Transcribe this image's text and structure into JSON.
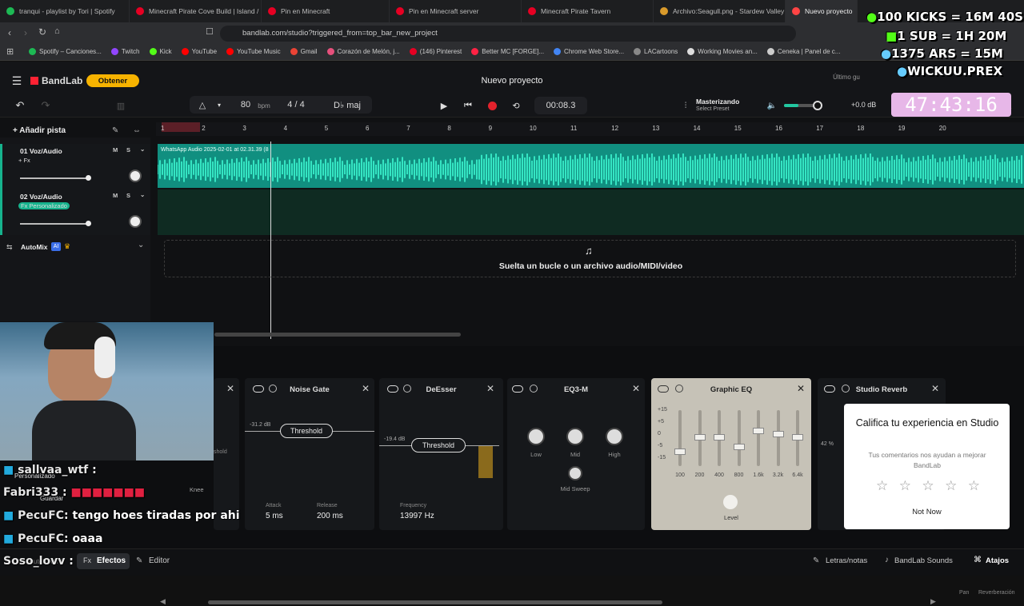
{
  "browser": {
    "tabs": [
      {
        "label": "tranqui - playlist by Tori | Spotify",
        "color": "#1db954"
      },
      {
        "label": "Minecraft Pirate Cove Build | Island /",
        "color": "#e60023"
      },
      {
        "label": "Pin en Minecraft",
        "color": "#e60023"
      },
      {
        "label": "Pin en Minecraft server",
        "color": "#e60023"
      },
      {
        "label": "Minecraft Pirate Tavern",
        "color": "#e60023"
      },
      {
        "label": "Archivo:Seagull.png - Stardew Valley",
        "color": "#d99a2b"
      },
      {
        "label": "Nuevo proyecto",
        "color": "#f44"
      }
    ],
    "url": "bandlab.com/studio?triggered_from=top_bar_new_project",
    "bookmarks": [
      {
        "label": "Spotify – Canciones...",
        "color": "#1db954"
      },
      {
        "label": "Twitch",
        "color": "#9146ff"
      },
      {
        "label": "Kick",
        "color": "#53fc18"
      },
      {
        "label": "YouTube",
        "color": "#f00"
      },
      {
        "label": "YouTube Music",
        "color": "#f00"
      },
      {
        "label": "Gmail",
        "color": "#ea4335"
      },
      {
        "label": "Corazón de Melón, j...",
        "color": "#e6507c"
      },
      {
        "label": "(146) Pinterest",
        "color": "#e60023"
      },
      {
        "label": "Better MC [FORGE]...",
        "color": "#f24"
      },
      {
        "label": "Chrome Web Store...",
        "color": "#4285f4"
      },
      {
        "label": "LACartoons",
        "color": "#888"
      },
      {
        "label": "Working Movies an...",
        "color": "#ddd"
      },
      {
        "label": "Ceneka | Panel de c...",
        "color": "#ccc"
      }
    ]
  },
  "studio": {
    "brand": "BandLab",
    "upgrade": "Obtener",
    "project_title": "Nuevo proyecto",
    "last_saved": "Último gu",
    "bpm": "80",
    "bpm_unit": "bpm",
    "time_sig": "4 / 4",
    "key": "D♭ maj",
    "time": "00:08.3",
    "mastering": "Masterizando",
    "preset": "Select Preset",
    "db": "+0.0 dB",
    "add_track": "Añadir pista",
    "ruler": [
      "1",
      "2",
      "3",
      "4",
      "5",
      "6",
      "7",
      "8",
      "9",
      "10",
      "11",
      "12",
      "13",
      "14",
      "15",
      "16",
      "17",
      "18",
      "19",
      "20"
    ],
    "tracks": [
      {
        "name": "01  Voz/Audio",
        "fx": "+ Fx",
        "m": "M",
        "s": "S"
      },
      {
        "name": "02  Voz/Audio",
        "fx": "Fx Personalizado",
        "m": "M",
        "s": "S"
      }
    ],
    "clip_label": "WhatsApp Audio 2025-02-01 at 02.31.39 (8",
    "automix": "AutoMix",
    "drop_text": "Suelta un bucle o un archivo audio/MIDI/video"
  },
  "effects": {
    "noise_gate": {
      "title": "Noise Gate",
      "threshold": "Threshold",
      "db": "-31.2 dB",
      "attack_label": "Attack",
      "attack": "5 ms",
      "release_label": "Release",
      "release": "200 ms"
    },
    "deesser": {
      "title": "DeEsser",
      "threshold": "Threshold",
      "db": "-19.4 dB",
      "freq_label": "Frequency",
      "freq": "13997 Hz"
    },
    "eq3": {
      "title": "EQ3-M",
      "low": "Low",
      "mid": "Mid",
      "high": "High",
      "sweep": "Mid Sweep"
    },
    "graphic_eq": {
      "title": "Graphic EQ",
      "scale": [
        "+15",
        "+5",
        "0",
        "-5",
        "-15"
      ],
      "bands": [
        "100",
        "200",
        "400",
        "800",
        "1.6k",
        "3.2k",
        "6.4k"
      ],
      "level": "Level"
    },
    "reverb": {
      "title": "Studio Reverb",
      "pct": "42 %"
    },
    "partial": {
      "knee": "Knee",
      "shold": "shold"
    }
  },
  "popup": {
    "title": "Califica tu experiencia en Studio",
    "subtitle": "Tus comentarios nos ayudan a mejorar BandLab",
    "dismiss": "Not Now"
  },
  "bottom": {
    "autopitch": "AutoPitch™",
    "effects": "Efectos",
    "editor": "Editor",
    "lyrics": "Letras/notas",
    "sounds": "BandLab Sounds",
    "shortcuts": "Atajos",
    "pan": "Pan",
    "reverb": "Reverberación",
    "save": "Guardar",
    "custom": "Personalizado"
  },
  "chat": [
    {
      "user": "sallvaa_wtf",
      "msg": ":"
    },
    {
      "user": "Fabri333",
      "msg": ":"
    },
    {
      "user": "PecuFC",
      "msg": ": tengo hoes tiradas por ahi"
    },
    {
      "user": "PecuFC",
      "msg": ": oaaa"
    },
    {
      "user": "Soso_lovv",
      "msg": ":"
    }
  ],
  "overlay": {
    "line1": "100 KICKS = 16M 40S",
    "line2": "1 SUB = 1H 20M",
    "line3": "1375 ARS = 15M",
    "line4": "WICKUU.PREX",
    "timer": "47:43:16"
  }
}
